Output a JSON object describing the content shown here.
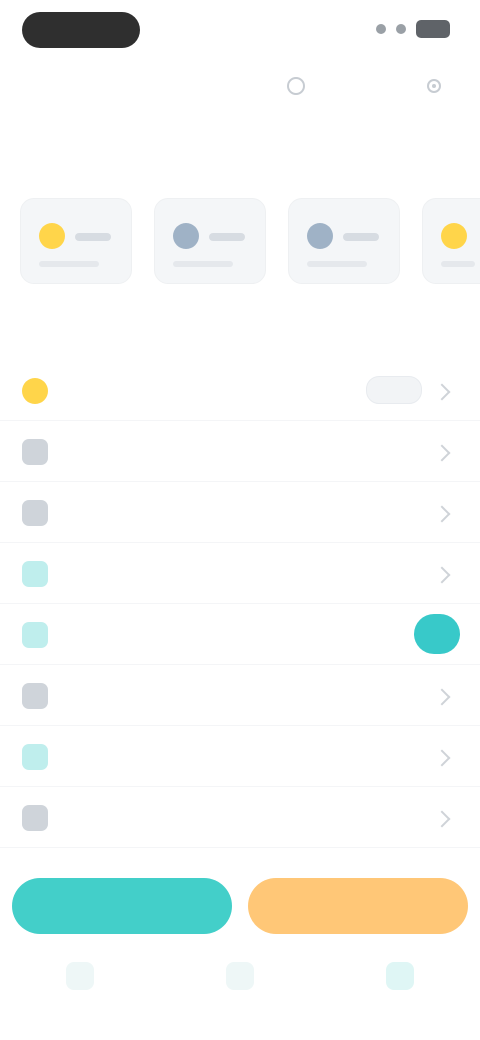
{
  "screen": {
    "title": "",
    "section_label": ""
  },
  "colors": {
    "accent": "#43cfc9",
    "secondary": "#ffc777",
    "icon_yellow": "#ffd54a",
    "icon_teal": "#4fd3cf",
    "icon_gray": "#9aa0a6"
  },
  "cards": [
    {
      "label": "",
      "icon": "sun-icon"
    },
    {
      "label": "",
      "icon": "cloud-icon"
    },
    {
      "label": "",
      "icon": "cloud-icon"
    },
    {
      "label": "",
      "icon": "sun-icon"
    }
  ],
  "list": [
    {
      "label": "",
      "icon": "sun-icon",
      "control": "chip"
    },
    {
      "label": "",
      "icon": "device-icon",
      "control": "chevron"
    },
    {
      "label": "",
      "icon": "device-icon",
      "control": "chevron"
    },
    {
      "label": "",
      "icon": "teal-icon",
      "control": "chevron"
    },
    {
      "label": "",
      "icon": "teal-icon",
      "control": "toggle"
    },
    {
      "label": "",
      "icon": "device-icon",
      "control": "chevron"
    },
    {
      "label": "",
      "icon": "teal-icon",
      "control": "chevron"
    },
    {
      "label": "",
      "icon": "device-icon",
      "control": "chevron"
    }
  ],
  "actions": {
    "primary_label": "",
    "secondary_label": ""
  },
  "tabs": [
    {
      "label": "",
      "icon": "home-icon",
      "active": false
    },
    {
      "label": "",
      "icon": "grid-icon",
      "active": false
    },
    {
      "label": "",
      "icon": "profile-icon",
      "active": true
    }
  ]
}
